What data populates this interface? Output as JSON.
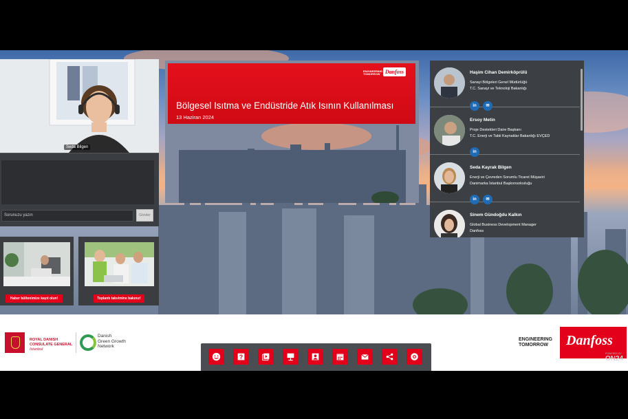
{
  "webcam": {
    "participant_name": "Seda Bilgen"
  },
  "chat": {
    "input_placeholder": "Sorunuzu yazın",
    "send_label": "Gönder"
  },
  "promos": [
    {
      "cta": "Haber bültenimize kayıt olun!"
    },
    {
      "cta": "Toplantı takvimine bakınız!"
    }
  ],
  "slide": {
    "title": "Bölgesel Isıtma ve Endüstride Atık Isının Kullanılması",
    "date": "13 Haziran 2024",
    "logo_text": "Danfoss",
    "eng_line1": "ENGINEERING",
    "eng_line2": "TOMORROW"
  },
  "speakers": [
    {
      "name": "Haşim Cihan Demirköprülü",
      "role1": "Sanayi Bölgeleri Genel Müdürlüğü",
      "role2": "T.C. Sanayi ve Teknoloji Bakanlığı",
      "social": [
        "linkedin",
        "email"
      ]
    },
    {
      "name": "Ersoy Metin",
      "role1": "Proje Destekleri Daire Başkanı",
      "role2": "T.C. Enerji ve Tabii Kaynaklar Bakanlığı EVÇED",
      "social": [
        "linkedin"
      ]
    },
    {
      "name": "Seda Kayrak Bilgen",
      "role1": "Enerji ve Çevreden Sorumlu Ticaret Müşaviri",
      "role2": "Danimarka İstanbul Başkonsolosluğu",
      "social": [
        "linkedin",
        "email"
      ]
    },
    {
      "name": "Sinem Gündoğdu Kalkın",
      "role1": "Global Business Development Manager",
      "role2": "Danfoss",
      "social": []
    }
  ],
  "footer": {
    "rdc_line1": "ROYAL DANISH",
    "rdc_line2": "CONSULATE GENERAL",
    "rdc_city": "İstanbul",
    "dggn_line1": "Danish",
    "dggn_line2": "Green Growth",
    "dggn_line3": "Network",
    "eng_line1": "ENGINEERING",
    "eng_line2": "TOMORROW",
    "danfoss": "Danfoss",
    "powered_by": "POWERED BY",
    "on24": "ON24"
  },
  "toolbar": {
    "icons": [
      "smile-icon",
      "help-icon",
      "media-icon",
      "presentation-icon",
      "person-icon",
      "calendar-icon",
      "email-icon",
      "share-icon",
      "support-icon"
    ]
  },
  "colors": {
    "brand_red": "#e2001a",
    "panel_dark": "#3c3f43",
    "linkedin_blue": "#1f6bb5"
  }
}
